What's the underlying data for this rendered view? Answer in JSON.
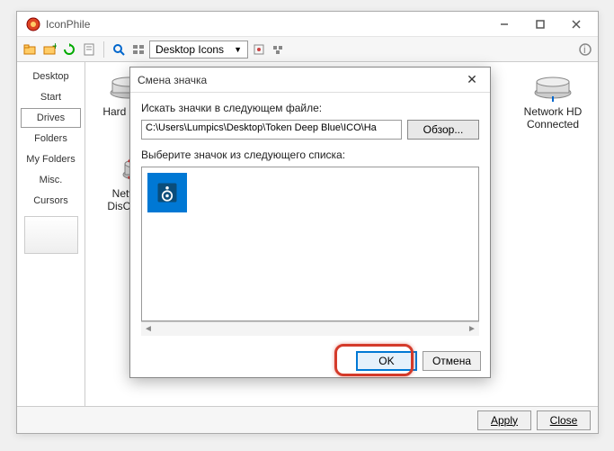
{
  "app": {
    "title": "IconPhile"
  },
  "toolbar": {
    "combo_label": "Desktop Icons"
  },
  "sidebar": {
    "tabs": [
      {
        "label": "Desktop"
      },
      {
        "label": "Start"
      },
      {
        "label": "Drives"
      },
      {
        "label": "Folders"
      },
      {
        "label": "My Folders"
      },
      {
        "label": "Misc."
      },
      {
        "label": "Cursors"
      }
    ],
    "active_index": 2
  },
  "icons": [
    {
      "label": "Hard Drive"
    },
    {
      "label": "Network HD DisConnected"
    },
    {
      "label": "Network HD Connected"
    }
  ],
  "footer": {
    "apply": "Apply",
    "close": "Close"
  },
  "dialog": {
    "title": "Смена значка",
    "search_label": "Искать значки в следующем файле:",
    "path": "C:\\Users\\Lumpics\\Desktop\\Token Deep Blue\\ICO\\Ha",
    "browse": "Обзор...",
    "list_label": "Выберите значок из следующего списка:",
    "ok": "OK",
    "cancel": "Отмена"
  }
}
